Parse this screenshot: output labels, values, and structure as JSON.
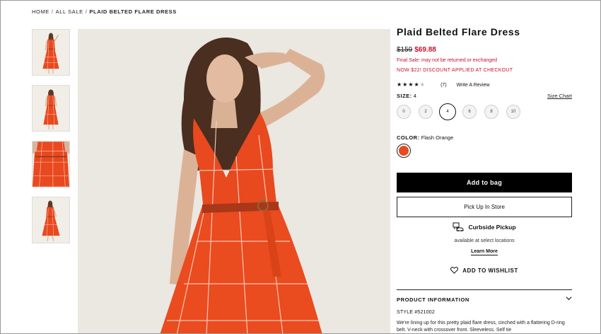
{
  "breadcrumb": {
    "items": [
      "HOME",
      "ALL SALE",
      "PLAID BELTED FLARE DRESS"
    ],
    "separator": "/"
  },
  "product": {
    "title": "Plaid Belted Flare Dress",
    "price_original": "$159",
    "price_sale": "$69.88",
    "final_sale_note": "Final Sale: may not be returned or exchanged",
    "discount_note": "NOW $22! DISCOUNT APPLIED AT CHECKOUT",
    "rating": {
      "stars": 4,
      "max": 5,
      "review_count": "(7)",
      "write_review_label": "Write A Review"
    },
    "size": {
      "label": "SIZE:",
      "selected": "4",
      "size_chart_label": "Size Chart",
      "options": [
        "0",
        "2",
        "4",
        "6",
        "8",
        "10"
      ]
    },
    "color": {
      "label": "COLOR:",
      "selected": "Flash Orange",
      "swatch_hex": "#e8491f"
    },
    "add_to_bag_label": "Add to bag",
    "pickup_label": "Pick Up In Store",
    "curbside": {
      "title": "Curbside Pickup",
      "subtitle": "available at select locations",
      "learn_more_label": "Learn More"
    },
    "wishlist_label": "ADD TO WISHLIST",
    "product_information": {
      "heading": "PRODUCT INFORMATION",
      "style_number": "STYLE #521002",
      "description": "We're lining up for this pretty plaid flare dress, cinched with a flattering D-ring belt. V-neck with crossover front. Sleeveless. Self tie"
    }
  },
  "colors": {
    "sale_red": "#c8102e",
    "dress_orange": "#e8491f",
    "button_black": "#000000"
  },
  "icons": {
    "star": "star-icon",
    "heart": "heart-icon",
    "curbside": "car-pickup-icon",
    "chevron": "chevron-down-icon"
  }
}
